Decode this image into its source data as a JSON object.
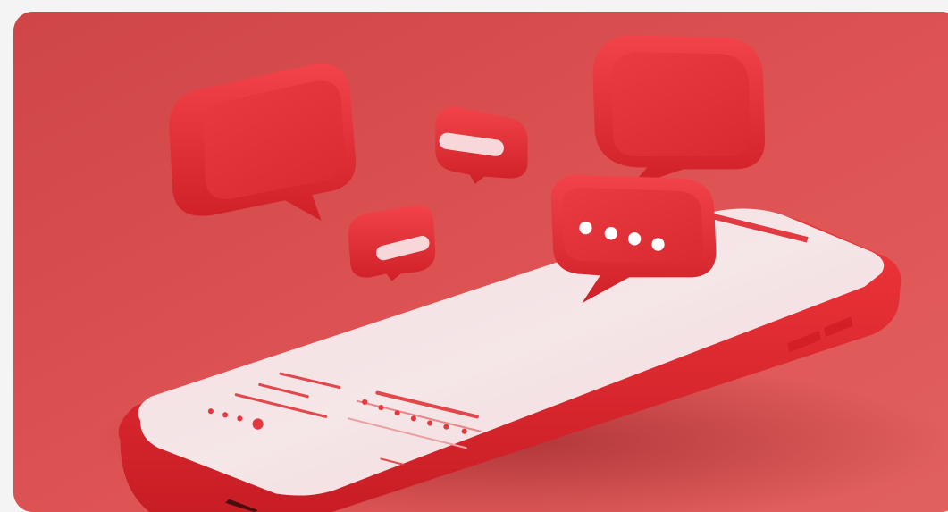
{
  "image": {
    "subject": "smartphone-with-chat-bubbles",
    "colors": {
      "background": "#d94a4c",
      "phone_body": "#e8282f",
      "phone_screen": "#f3e4e6",
      "bubble": "#e8262c",
      "bubble_highlight": "#ff5a5c",
      "screen_marks": "#e4484c"
    }
  }
}
